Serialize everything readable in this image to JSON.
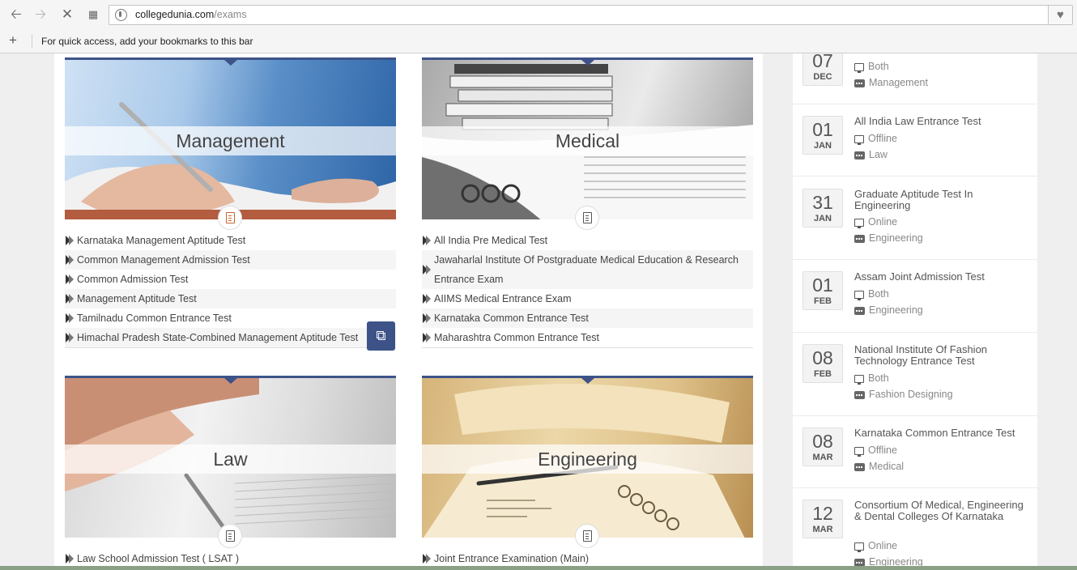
{
  "browser": {
    "url_domain": "collegedunia.com",
    "url_path": "/exams",
    "bookmarks_hint": "For quick access, add your bookmarks to this bar"
  },
  "categories": [
    {
      "title": "Management",
      "exams": [
        "Karnataka Management Aptitude Test",
        "Common Management Admission Test",
        "Common Admission Test",
        "Management Aptitude Test",
        "Tamilnadu Common Entrance Test",
        "Himachal Pradesh State-Combined Management Aptitude Test"
      ]
    },
    {
      "title": "Medical",
      "exams": [
        "All India Pre Medical Test",
        "Jawaharlal Institute Of Postgraduate Medical Education & Research Entrance Exam",
        "AIIMS Medical Entrance Exam",
        "Karnataka Common Entrance Test",
        "Maharashtra Common Entrance Test"
      ]
    },
    {
      "title": "Law",
      "exams": [
        "Law School Admission Test ( LSAT )"
      ]
    },
    {
      "title": "Engineering",
      "exams": [
        "Joint Entrance Examination (Main)"
      ]
    }
  ],
  "events": [
    {
      "day": "07",
      "month": "DEC",
      "title": "",
      "mode": "Both",
      "category": "Management"
    },
    {
      "day": "01",
      "month": "JAN",
      "title": "All India Law Entrance Test",
      "mode": "Offline",
      "category": "Law"
    },
    {
      "day": "31",
      "month": "JAN",
      "title": "Graduate Aptitude Test In Engineering",
      "mode": "Online",
      "category": "Engineering"
    },
    {
      "day": "01",
      "month": "FEB",
      "title": "Assam Joint Admission Test",
      "mode": "Both",
      "category": "Engineering"
    },
    {
      "day": "08",
      "month": "FEB",
      "title": "National Institute Of Fashion Technology Entrance Test",
      "mode": "Both",
      "category": "Fashion Designing"
    },
    {
      "day": "08",
      "month": "MAR",
      "title": "Karnataka Common Entrance Test",
      "mode": "Offline",
      "category": "Medical"
    },
    {
      "day": "12",
      "month": "MAR",
      "title": "Consortium Of Medical, Engineering & Dental Colleges Of Karnataka",
      "mode": "Online",
      "category": "Engineering"
    }
  ],
  "colors": {
    "accent": "#3d5388",
    "text": "#444444",
    "muted": "#888888"
  },
  "icons": {
    "back": "arrow-left-icon",
    "forward": "arrow-right-icon",
    "stop": "close-icon",
    "apps": "apps-grid-icon",
    "favorite": "heart-icon",
    "external": "external-link-icon"
  }
}
